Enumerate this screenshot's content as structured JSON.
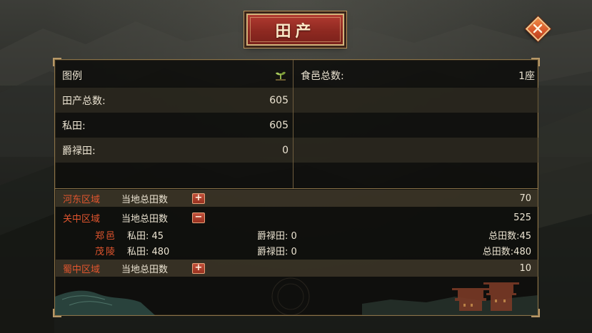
{
  "title": "田产",
  "close_icon": "close-x-icon",
  "colors": {
    "title_red": "#9a2e25",
    "region_red": "#e0552e",
    "close_orange": "#e06a33",
    "border_gold": "#8b7348"
  },
  "summary": {
    "legend_label": "图例",
    "legend_icon": "farmland-sprout-icon",
    "rows": [
      {
        "label": "田产总数:",
        "value": "605"
      },
      {
        "label": "私田:",
        "value": "605"
      },
      {
        "label": "爵禄田:",
        "value": "0"
      }
    ],
    "fief": {
      "label": "食邑总数:",
      "value": "1座"
    }
  },
  "regions": [
    {
      "name": "河东区域",
      "sub_label": "当地总田数",
      "toggle": "+",
      "total": "70",
      "expanded": false
    },
    {
      "name": "关中区域",
      "sub_label": "当地总田数",
      "toggle": "−",
      "total": "525",
      "expanded": true
    },
    {
      "name": "蜀中区域",
      "sub_label": "当地总田数",
      "toggle": "+",
      "total": "10",
      "expanded": false
    }
  ],
  "counties": [
    {
      "name": "郑邑",
      "private": "私田: 45",
      "rank": "爵禄田: 0",
      "total": "总田数:45"
    },
    {
      "name": "茂陵",
      "private": "私田: 480",
      "rank": "爵禄田: 0",
      "total": "总田数:480"
    }
  ]
}
